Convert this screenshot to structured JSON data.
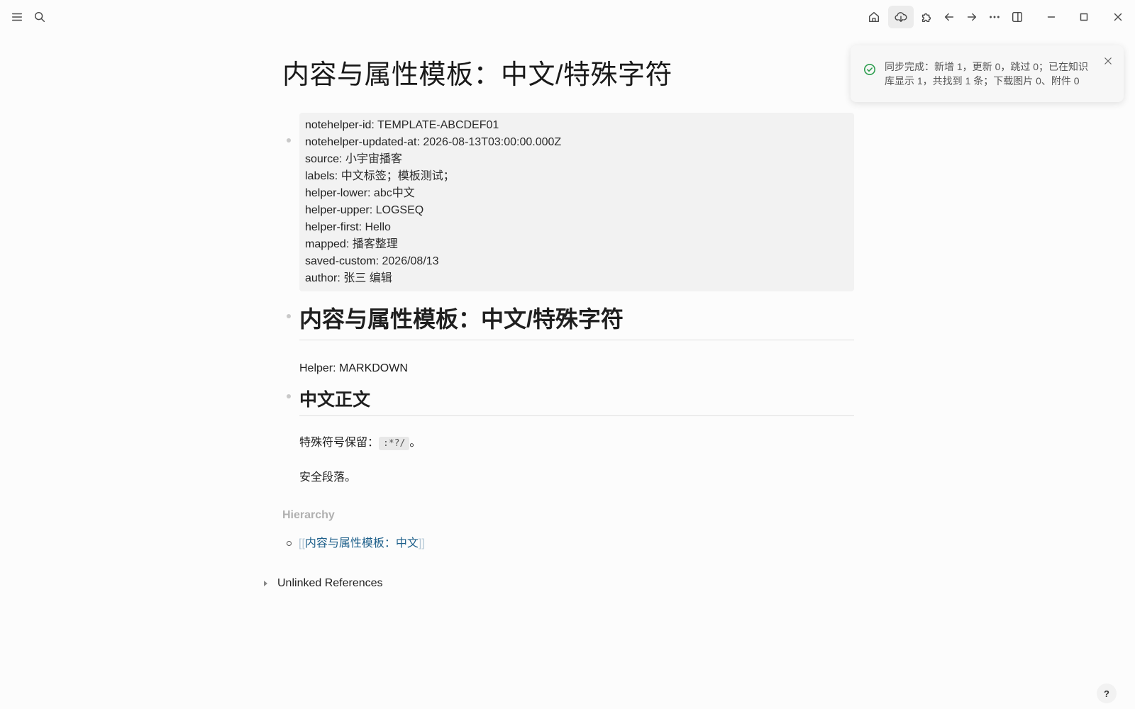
{
  "toolbar": {
    "left_icons": [
      "menu-icon",
      "search-icon"
    ],
    "right_icons": [
      "home-icon",
      "cloud-sync-icon",
      "puzzle-icon",
      "arrow-left-icon",
      "arrow-right-icon",
      "more-icon",
      "sidebar-toggle-icon",
      "minimize-icon",
      "maximize-icon",
      "close-icon"
    ]
  },
  "page": {
    "title": "内容与属性模板：中文/特殊字符",
    "properties": [
      {
        "key": "notehelper-id:",
        "value": " TEMPLATE-ABCDEF01"
      },
      {
        "key": "notehelper-updated-at:",
        "value": " 2026-08-13T03:00:00.000Z"
      },
      {
        "key": "source:",
        "value": " 小宇宙播客"
      },
      {
        "key": "labels:",
        "value": " 中文标签；模板测试；"
      },
      {
        "key": "helper-lower:",
        "value": " abc中文"
      },
      {
        "key": "helper-upper:",
        "value": " LOGSEQ"
      },
      {
        "key": "helper-first:",
        "value": " Hello"
      },
      {
        "key": "mapped:",
        "value": " 播客整理"
      },
      {
        "key": "saved-custom:",
        "value": " 2026/08/13"
      },
      {
        "key": "author:",
        "value": " 张三 编辑"
      }
    ],
    "heading1": "内容与属性模板：中文/特殊字符",
    "helper_line": "Helper: MARKDOWN",
    "heading2": "中文正文",
    "special_prefix": "特殊符号保留：",
    "special_code": ":*?/",
    "special_suffix": "。",
    "safe_paragraph": "安全段落。"
  },
  "hierarchy": {
    "title": "Hierarchy",
    "open_bracket": "[[",
    "link_text": "内容与属性模板：中文",
    "close_bracket": "]]"
  },
  "unlinked_references": "Unlinked References",
  "toast": {
    "line1": "同步完成：新增 1，更新 0，跳过 0；已在知识",
    "line2": "库显示 1，共找到 1 条；下载图片 0、附件 0",
    "status_color": "#2e9e4f"
  },
  "help_label": "?"
}
